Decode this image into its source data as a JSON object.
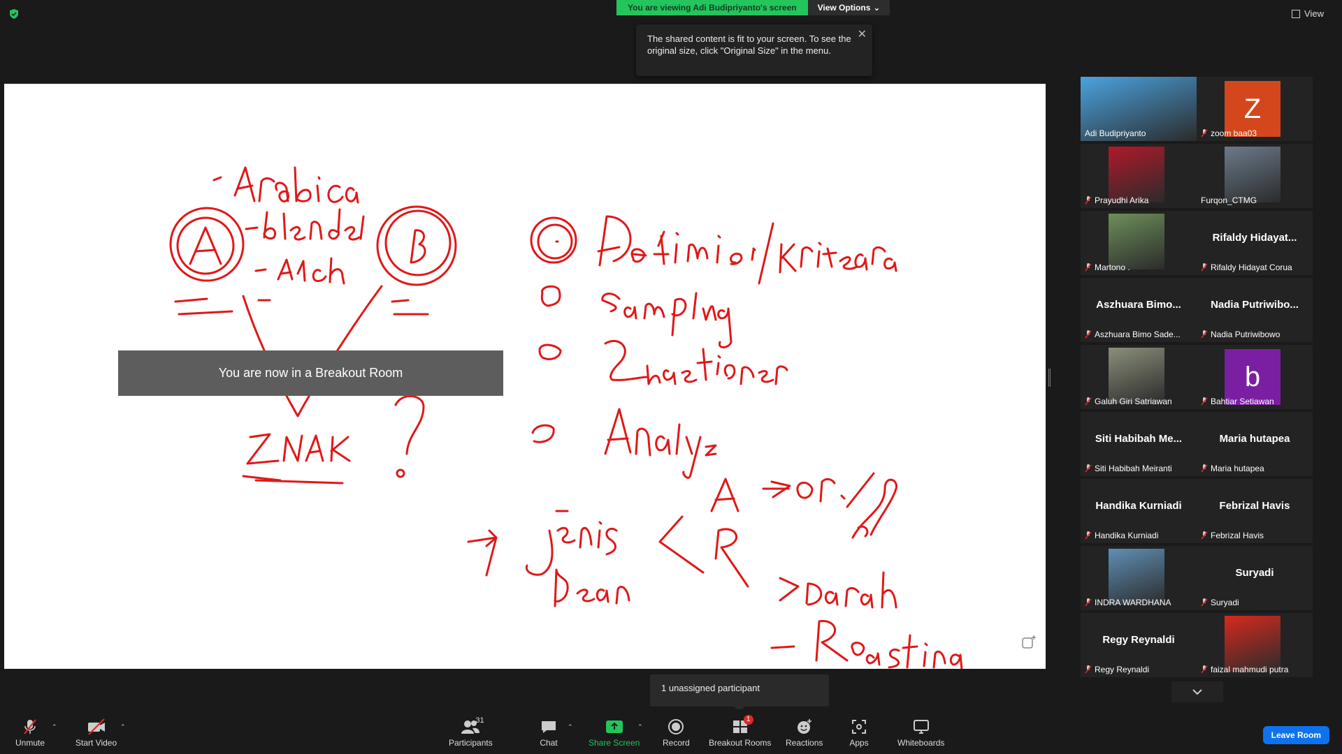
{
  "banner": {
    "viewing_text": "You are viewing Adi Budipriyanto's screen",
    "view_options": "View Options"
  },
  "view_top": "View",
  "tooltip": {
    "text": "The shared content is fit to your screen. To see the original size, click \"Original Size\" in the menu."
  },
  "share": {
    "toast": "You are now in a Breakout Room"
  },
  "participants": [
    {
      "caption": "Adi Budipriyanto",
      "kind": "photo",
      "color": "#4aa3e0",
      "active": true,
      "muted": false
    },
    {
      "caption": "zoom baa03",
      "kind": "letter",
      "letter": "Z",
      "color": "#d4471c",
      "muted": true
    },
    {
      "caption": "Prayudhi Arika",
      "kind": "photo",
      "color": "#b0192a",
      "muted": true
    },
    {
      "caption": "Furqon_CTMG",
      "kind": "photo",
      "color": "#6b7a8a",
      "muted": false
    },
    {
      "caption": "Martono .",
      "kind": "photo",
      "color": "#6d8f5a",
      "muted": true
    },
    {
      "caption": "Rifaldy Hidayat Corua",
      "name": "Rifaldy  Hidayat...",
      "kind": "name",
      "muted": true
    },
    {
      "caption": "Aszhuara Bimo Sade...",
      "name": "Aszhuara  Bimo...",
      "kind": "name",
      "muted": true
    },
    {
      "caption": "Nadia Putriwibowo",
      "name": "Nadia  Putriwibo...",
      "kind": "name",
      "muted": true
    },
    {
      "caption": "Galuh Giri Satriawan",
      "kind": "photo",
      "color": "#8a8f7a",
      "muted": true
    },
    {
      "caption": "Bahtiar Setiawan",
      "kind": "letter",
      "letter": "b",
      "color": "#7a1fa2",
      "muted": true
    },
    {
      "caption": "Siti Habibah Meiranti",
      "name": "Siti  Habibah  Me...",
      "kind": "name",
      "muted": true
    },
    {
      "caption": "Maria hutapea",
      "name": "Maria hutapea",
      "kind": "name",
      "muted": true
    },
    {
      "caption": "Handika Kurniadi",
      "name": "Handika Kurniadi",
      "kind": "name",
      "muted": true
    },
    {
      "caption": "Febrizal Havis",
      "name": "Febrizal Havis",
      "kind": "name",
      "muted": true
    },
    {
      "caption": "INDRA WARDHANA",
      "kind": "photo",
      "color": "#5f8fb5",
      "muted": true
    },
    {
      "caption": "Suryadi",
      "name": "Suryadi",
      "kind": "name",
      "muted": true
    },
    {
      "caption": "Regy Reynaldi",
      "name": "Regy Reynaldi",
      "kind": "name",
      "muted": true
    },
    {
      "caption": "faizal mahmudi putra",
      "kind": "photo",
      "color": "#d62a1e",
      "muted": true
    }
  ],
  "unassigned": "1 unassigned participant",
  "toolbar": {
    "unmute": "Unmute",
    "start_video": "Start Video",
    "participants": "Participants",
    "participants_count": "31",
    "chat": "Chat",
    "share_screen": "Share Screen",
    "record": "Record",
    "breakout_rooms": "Breakout Rooms",
    "breakout_badge": "1",
    "reactions": "Reactions",
    "apps": "Apps",
    "whiteboards": "Whiteboards",
    "leave_room": "Leave Room"
  },
  "colors": {
    "accent_green": "#23c55c",
    "ink_red": "#e01818",
    "leave_blue": "#0e72ed",
    "active_border": "#c6e14a"
  }
}
